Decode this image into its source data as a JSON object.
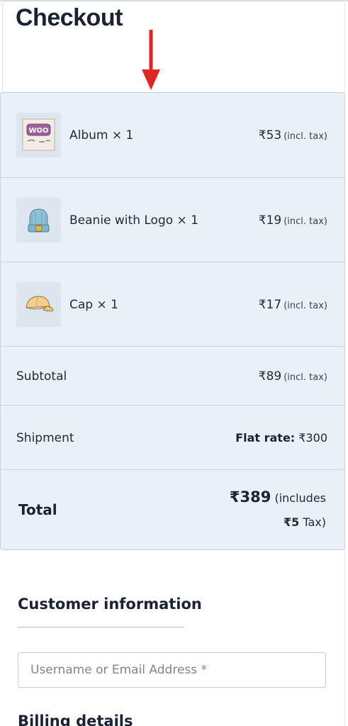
{
  "page": {
    "title": "Checkout"
  },
  "annotation": {
    "arrow_color": "#e02525"
  },
  "order": {
    "items": [
      {
        "name": "Album × 1",
        "price": "₹53",
        "tax_note": "(incl. tax)",
        "icon": "album-woo-icon"
      },
      {
        "name": "Beanie with Logo × 1",
        "price": "₹19",
        "tax_note": "(incl. tax)",
        "icon": "beanie-icon"
      },
      {
        "name": "Cap × 1",
        "price": "₹17",
        "tax_note": "(incl. tax)",
        "icon": "cap-icon"
      }
    ],
    "subtotal": {
      "label": "Subtotal",
      "price": "₹89",
      "tax_note": "(incl. tax)"
    },
    "shipment": {
      "label": "Shipment",
      "method": "Flat rate:",
      "price": "₹300"
    },
    "total": {
      "label": "Total",
      "amount": "₹389",
      "includes_prefix": "(includes",
      "tax_amount": "₹5",
      "tax_suffix": "Tax)"
    }
  },
  "customer_information": {
    "heading": "Customer information",
    "username_placeholder": "Username or Email Address *"
  },
  "billing": {
    "heading": "Billing details"
  }
}
